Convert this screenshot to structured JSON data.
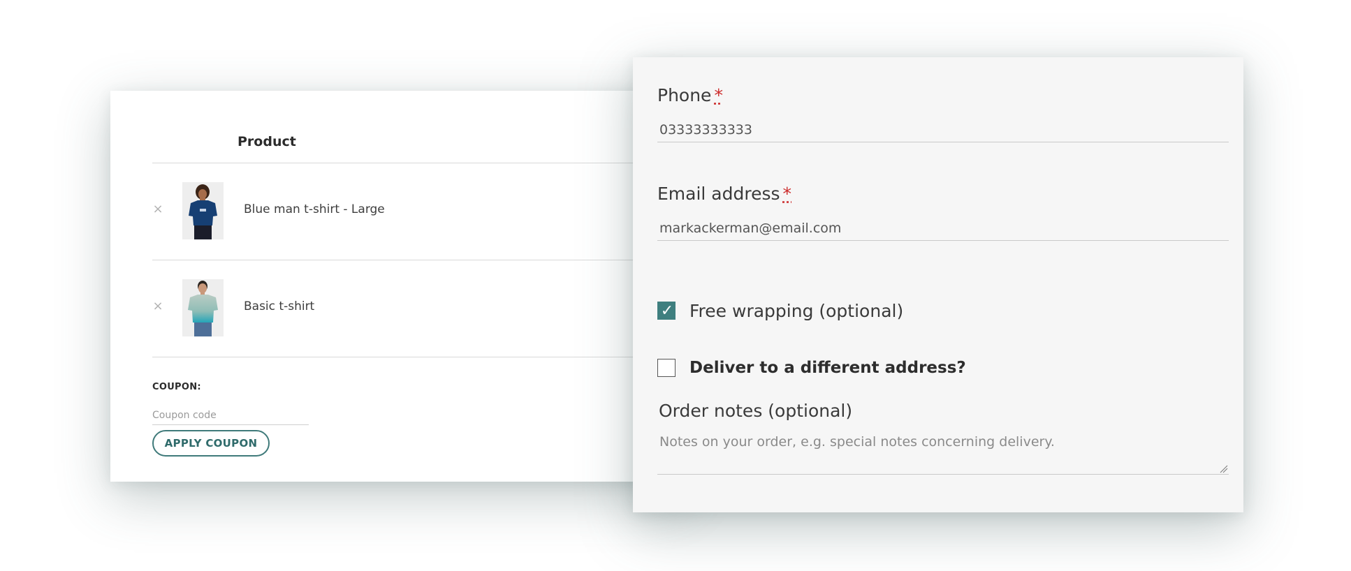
{
  "cart": {
    "column_product": "Product",
    "items": [
      {
        "name": "Blue man t-shirt - Large",
        "remove_icon": "×",
        "image_icon": "blue-tshirt-photo",
        "shirt_color": "#163f73"
      },
      {
        "name": "Basic t-shirt",
        "remove_icon": "×",
        "image_icon": "teal-gradient-tshirt-photo",
        "shirt_color": "#8fbdb6"
      }
    ],
    "coupon_label": "COUPON:",
    "coupon_placeholder": "Coupon code",
    "apply_label": "APPLY COUPON"
  },
  "checkout": {
    "phone_label": "Phone",
    "phone_value": "03333333333",
    "email_label": "Email address",
    "email_value": "markackerman@email.com",
    "required_mark": "*",
    "free_wrapping_label": "Free wrapping (optional)",
    "free_wrapping_checked": true,
    "different_address_label": "Deliver to a different address?",
    "different_address_checked": false,
    "notes_label": "Order notes (optional)",
    "notes_placeholder": "Notes on your order, e.g. special notes concerning delivery.",
    "check_glyph": "✓"
  },
  "colors": {
    "accent": "#3f7f7f",
    "required": "#cc2a2a",
    "card_bg": "#f6f6f6"
  }
}
